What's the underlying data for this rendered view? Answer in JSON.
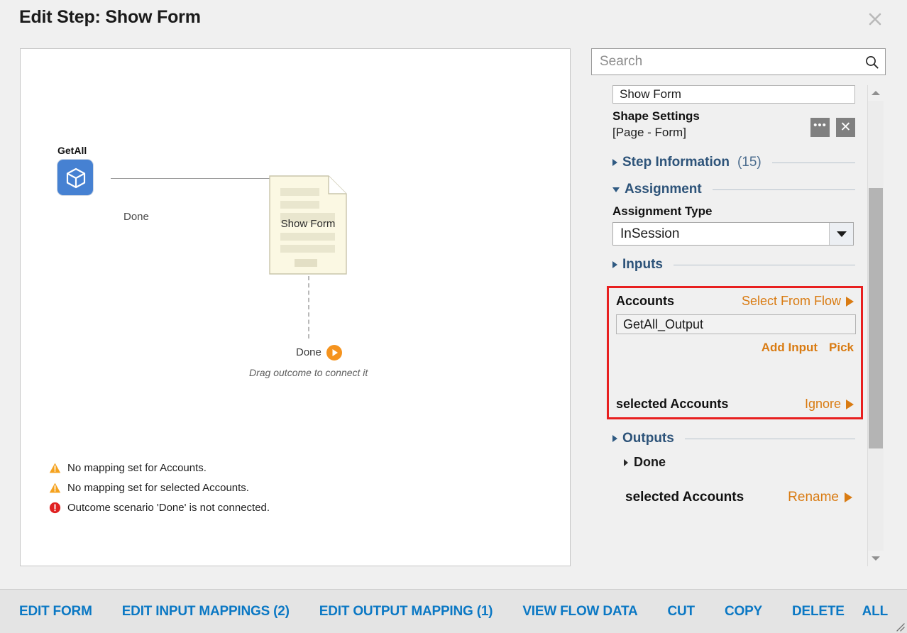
{
  "dialog": {
    "title": "Edit Step: Show Form",
    "close_icon": "close-icon"
  },
  "canvas": {
    "nodes": [
      {
        "label": "GetAll",
        "icon": "cube-icon"
      },
      {
        "label": "Show Form",
        "icon": "page-form-icon"
      }
    ],
    "connector_label": "Done",
    "outcome": {
      "label": "Done",
      "icon": "play-circle-icon",
      "hint": "Drag outcome to connect it"
    },
    "validations": [
      {
        "severity": "warning",
        "icon": "warning-triangle-icon",
        "text": "No mapping set for Accounts."
      },
      {
        "severity": "warning",
        "icon": "warning-triangle-icon",
        "text": "No mapping set for selected Accounts."
      },
      {
        "severity": "error",
        "icon": "error-circle-icon",
        "text": "Outcome scenario 'Done' is not connected."
      }
    ]
  },
  "panel": {
    "search": {
      "placeholder": "Search",
      "value": "",
      "icon": "search-icon"
    },
    "step_name": {
      "value": "Show Form"
    },
    "shape_settings": {
      "title": "Shape Settings",
      "subtitle": "[Page - Form]",
      "more_label": "•••",
      "close_label": "✕"
    },
    "sections": {
      "step_information": {
        "title": "Step Information",
        "count": "(15)",
        "expanded": false
      },
      "assignment": {
        "title": "Assignment",
        "expanded": true,
        "assignment_type_label": "Assignment Type",
        "assignment_type_value": "InSession"
      },
      "inputs": {
        "title": "Inputs",
        "expanded": false
      },
      "outputs": {
        "title": "Outputs",
        "expanded": false
      }
    },
    "input_mapping": {
      "highlighted": true,
      "highlight_color": "#e81f1f",
      "accounts": {
        "name": "Accounts",
        "action": "Select From Flow",
        "value": "GetAll_Output",
        "add_input": "Add Input",
        "pick": "Pick"
      },
      "selected_accounts": {
        "name": "selected Accounts",
        "action": "Ignore"
      }
    },
    "outputs_detail": {
      "done_label": "Done",
      "selected_accounts_name": "selected Accounts",
      "rename_action": "Rename"
    },
    "scrollbar": {
      "up_icon": "chevron-up-icon",
      "down_icon": "chevron-down-icon"
    }
  },
  "footer": {
    "buttons": [
      "EDIT FORM",
      "EDIT INPUT MAPPINGS (2)",
      "EDIT OUTPUT MAPPING (1)",
      "VIEW FLOW DATA",
      "CUT",
      "COPY",
      "DELETE"
    ],
    "all_label": "ALL"
  },
  "colors": {
    "accent_orange": "#d97b12",
    "link_blue": "#0b78c4",
    "section_blue": "#2d5379",
    "node_blue": "#4681d2",
    "highlight_red": "#e81f1f",
    "warning_orange": "#f5a21e",
    "error_red": "#e02020"
  }
}
